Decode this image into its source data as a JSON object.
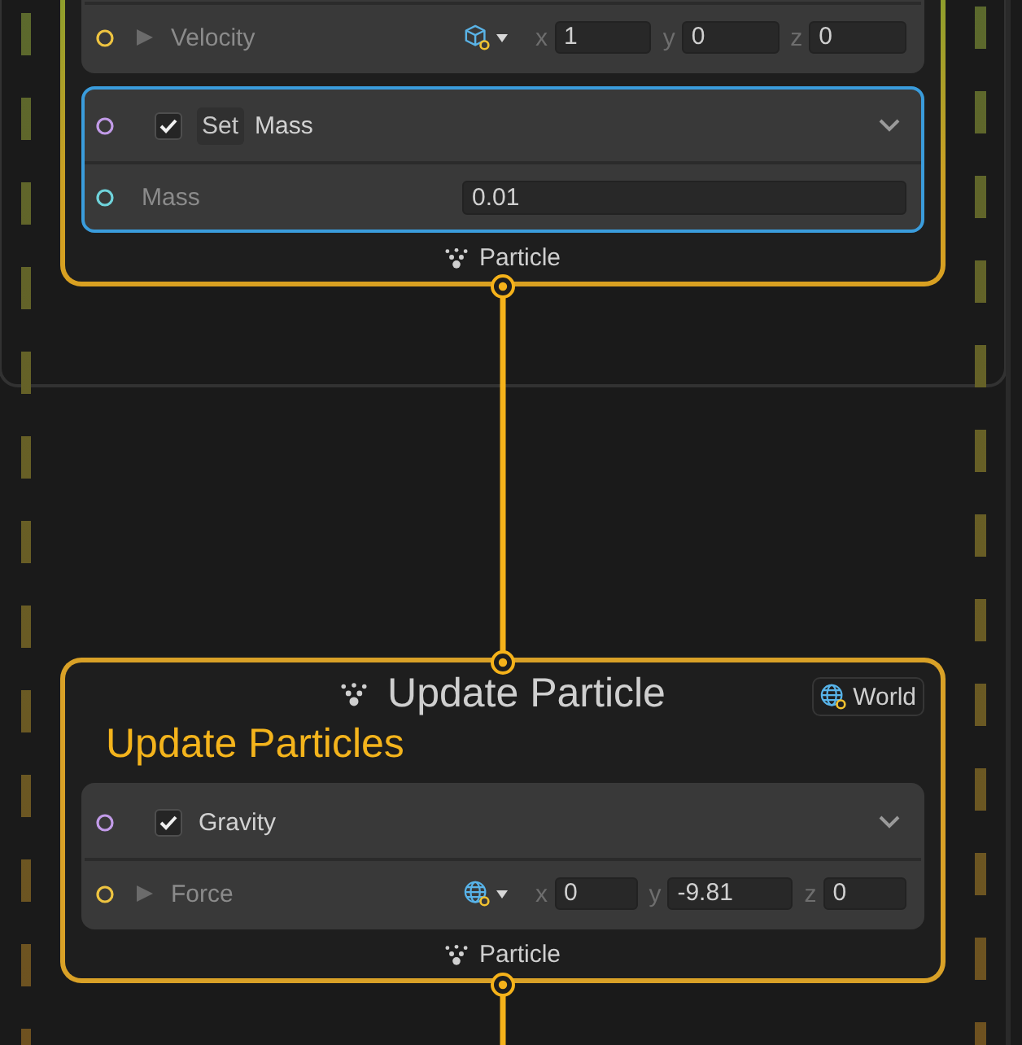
{
  "contexts": [
    {
      "kind": "initialize",
      "blocks": [
        {
          "kind": "partial",
          "selected": false,
          "rows": [
            {
              "kind": "vector",
              "label": "Velocity",
              "expanded": false,
              "world_space": false,
              "components": [
                {
                  "axis": "x",
                  "value": "1"
                },
                {
                  "axis": "y",
                  "value": "0"
                },
                {
                  "axis": "z",
                  "value": "0"
                }
              ]
            }
          ]
        },
        {
          "kind": "full",
          "selected": true,
          "checked": true,
          "prefix": "Set",
          "title": "Mass",
          "rows": [
            {
              "kind": "float",
              "label": "Mass",
              "value": "0.01"
            }
          ]
        }
      ],
      "output": "Particle"
    },
    {
      "kind": "update",
      "title": "Update Particle",
      "space_badge": "World",
      "subtitle": "Update Particles",
      "blocks": [
        {
          "kind": "full",
          "selected": false,
          "checked": true,
          "title": "Gravity",
          "rows": [
            {
              "kind": "vector",
              "label": "Force",
              "expanded": false,
              "world_space": true,
              "components": [
                {
                  "axis": "x",
                  "value": "0"
                },
                {
                  "axis": "y",
                  "value": "-9.81"
                },
                {
                  "axis": "z",
                  "value": "0"
                }
              ]
            }
          ]
        }
      ],
      "output": "Particle"
    }
  ]
}
